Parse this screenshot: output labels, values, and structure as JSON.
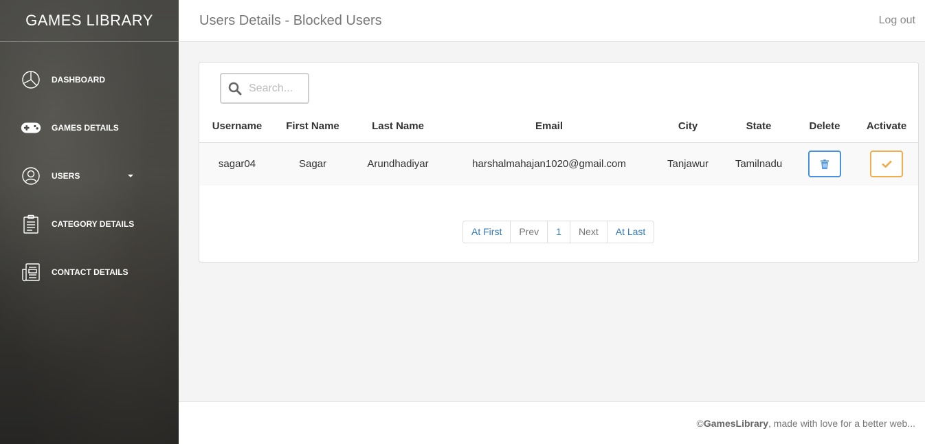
{
  "brand": "GAMES LIBRARY",
  "sidebar": {
    "items": [
      {
        "label": "DASHBOARD",
        "icon": "pie-chart-icon"
      },
      {
        "label": "GAMES DETAILS",
        "icon": "gamepad-icon"
      },
      {
        "label": "USERS",
        "icon": "user-icon"
      },
      {
        "label": "CATEGORY DETAILS",
        "icon": "clipboard-icon"
      },
      {
        "label": "CONTACT DETAILS",
        "icon": "newspaper-icon"
      }
    ]
  },
  "header": {
    "title": "Users Details - Blocked Users",
    "logout": "Log out"
  },
  "search": {
    "placeholder": "Search..."
  },
  "table": {
    "headers": [
      "Username",
      "First Name",
      "Last Name",
      "Email",
      "City",
      "State",
      "Delete",
      "Activate"
    ],
    "rows": [
      [
        "sagar04",
        "Sagar",
        "Arundhadiyar",
        "harshalmahajan1020@gmail.com",
        "Tanjawur",
        "Tamilnadu"
      ]
    ]
  },
  "pagination": [
    "At First",
    "Prev",
    "1",
    "Next",
    "At Last"
  ],
  "footer": {
    "prefix": "© ",
    "brand": "GamesLibrary",
    "suffix": ", made with love for a better web..."
  },
  "colors": {
    "delete": "#4a90e2",
    "activate": "#f0ad4e",
    "link": "#337ab7"
  }
}
